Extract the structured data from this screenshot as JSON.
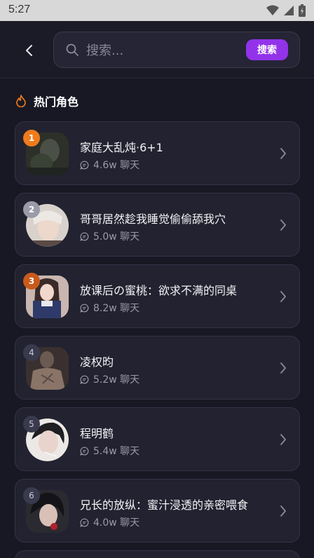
{
  "status": {
    "time": "5:27"
  },
  "search": {
    "placeholder": "搜索...",
    "button_label": "搜索"
  },
  "section": {
    "title": "热门角色"
  },
  "colors": {
    "accent": "#9233ea",
    "rank1": "#f07b1b",
    "rank2": "#9a9aa8",
    "rank3": "#c85a1c",
    "background": "#181824"
  },
  "characters": [
    {
      "rank": "1",
      "name": "家庭大乱炖·6+1",
      "chats": "4.6w 聊天"
    },
    {
      "rank": "2",
      "name": "哥哥居然趁我睡觉偷偷舔我穴",
      "chats": "5.0w 聊天"
    },
    {
      "rank": "3",
      "name": "放课后の蜜桃：欲求不满的同桌",
      "chats": "8.2w 聊天"
    },
    {
      "rank": "4",
      "name": "凌权昀",
      "chats": "5.2w 聊天"
    },
    {
      "rank": "5",
      "name": "程明鹤",
      "chats": "5.4w 聊天"
    },
    {
      "rank": "6",
      "name": "兄长的放纵：蜜汁浸透的亲密喂食",
      "chats": "4.0w 聊天"
    }
  ]
}
